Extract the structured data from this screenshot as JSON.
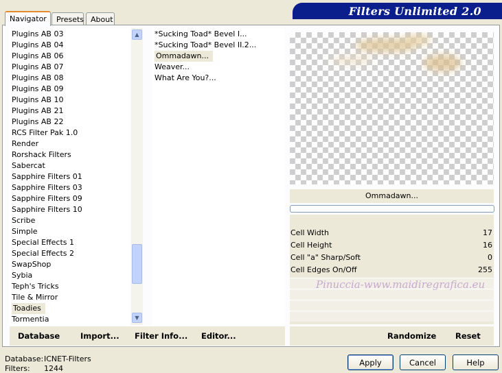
{
  "tabs": [
    {
      "label": "Navigator",
      "active": true
    },
    {
      "label": "Presets",
      "active": false
    },
    {
      "label": "About",
      "active": false
    }
  ],
  "banner": {
    "title": "Filters Unlimited 2.0",
    "color": "#0a1e8c"
  },
  "categories": {
    "items": [
      "Plugins AB 03",
      "Plugins AB 04",
      "Plugins AB 06",
      "Plugins AB 07",
      "Plugins AB 08",
      "Plugins AB 09",
      "Plugins AB 10",
      "Plugins AB 21",
      "Plugins AB 22",
      "RCS Filter Pak 1.0",
      "Render",
      "Rorshack Filters",
      "Sabercat",
      "Sapphire Filters 01",
      "Sapphire Filters 03",
      "Sapphire Filters 09",
      "Sapphire Filters 10",
      "Scribe",
      "Simple",
      "Special Effects 1",
      "Special Effects 2",
      "SwapShop",
      "Sybia",
      "Teph's Tricks",
      "Tile & Mirror",
      "Toadies",
      "Tormentia"
    ],
    "selected": "Toadies"
  },
  "filters": {
    "items": [
      "*Sucking Toad*  Bevel I...",
      "*Sucking Toad*  Bevel II.2...",
      "Ommadawn...",
      "Weaver...",
      "What Are You?..."
    ],
    "selected": "Ommadawn..."
  },
  "preview": {
    "filter_name": "Ommadawn..."
  },
  "params": [
    {
      "label": "Cell Width",
      "value": "17"
    },
    {
      "label": "Cell Height",
      "value": "16"
    },
    {
      "label": "Cell \"a\" Sharp/Soft",
      "value": "0"
    },
    {
      "label": "Cell Edges On/Off",
      "value": "255"
    }
  ],
  "watermark": "Pinuccia-www.maidiregrafica.eu",
  "toolbar": {
    "database": "Database",
    "import": "Import...",
    "filter_info": "Filter Info...",
    "editor": "Editor...",
    "randomize": "Randomize",
    "reset": "Reset"
  },
  "status": {
    "database_label": "Database:",
    "database_value": "ICNET-Filters",
    "filters_label": "Filters:",
    "filters_value": "1244"
  },
  "dialog": {
    "apply": "Apply",
    "cancel": "Cancel",
    "help": "Help"
  }
}
